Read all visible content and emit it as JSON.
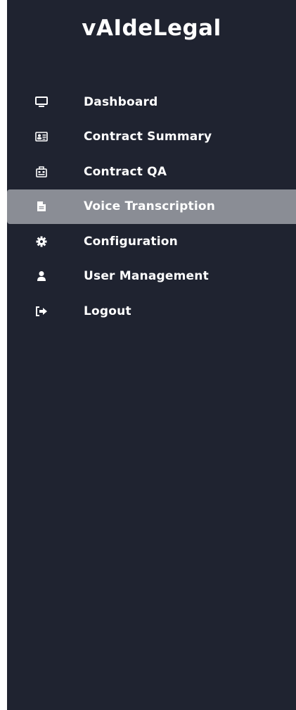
{
  "sidebar": {
    "brand": "vAIdeLegal",
    "colors": {
      "background": "#1f2330",
      "active_background": "#8a8d95",
      "text": "#ffffff"
    },
    "items": [
      {
        "label": "Dashboard",
        "icon": "monitor-icon",
        "active": false
      },
      {
        "label": "Contract Summary",
        "icon": "id-card-icon",
        "active": false
      },
      {
        "label": "Contract QA",
        "icon": "briefcase-icon",
        "active": false
      },
      {
        "label": "Voice Transcription",
        "icon": "file-icon",
        "active": true
      },
      {
        "label": "Configuration",
        "icon": "gear-icon",
        "active": false
      },
      {
        "label": "User Management",
        "icon": "user-icon",
        "active": false
      },
      {
        "label": "Logout",
        "icon": "logout-icon",
        "active": false
      }
    ]
  }
}
